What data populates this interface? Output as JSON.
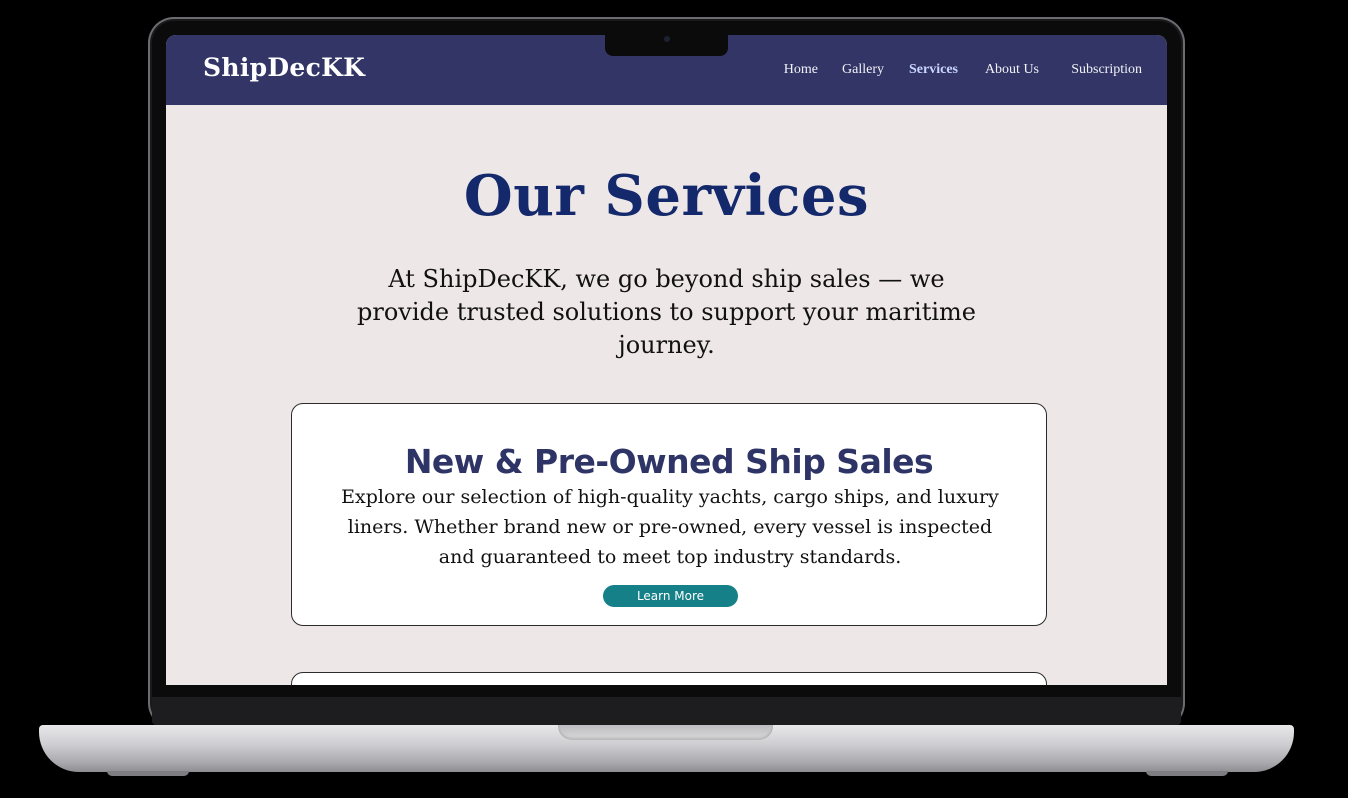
{
  "site": {
    "brand": "ShipDecKK",
    "nav": [
      {
        "label": "Home",
        "active": false
      },
      {
        "label": "Gallery",
        "active": false
      },
      {
        "label": "Services",
        "active": true
      },
      {
        "label": "About Us",
        "active": false
      },
      {
        "label": "Subscription",
        "active": false
      }
    ]
  },
  "page": {
    "title": "Our Services",
    "intro": "At ShipDecKK, we go beyond ship sales — we provide trusted solutions to support your maritime journey."
  },
  "cards": [
    {
      "title": "New & Pre-Owned Ship Sales",
      "text": "Explore our selection of high-quality yachts, cargo ships, and luxury liners. Whether brand new or pre-owned, every vessel is inspected and guaranteed to meet top industry standards.",
      "button": "Learn More"
    }
  ],
  "colors": {
    "navbar": "#323566",
    "title": "#13296b",
    "background": "#eee7e8",
    "button": "#168088",
    "active_nav": "#c9d4ff"
  }
}
